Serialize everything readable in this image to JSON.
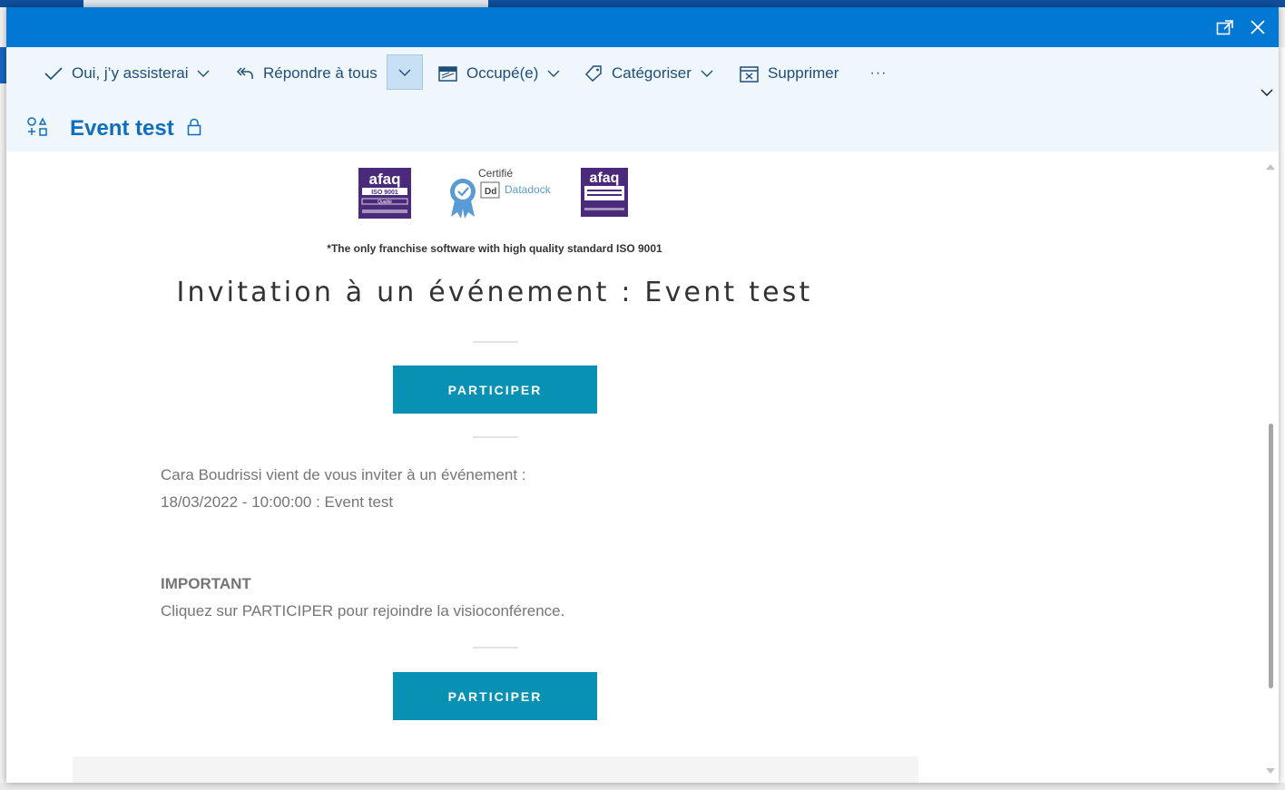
{
  "window": {
    "popout_icon": "popout-icon",
    "close_icon": "close-icon"
  },
  "toolbar": {
    "accept_label": "Oui, j’y assisterai",
    "reply_all_label": "Répondre à tous",
    "busy_label": "Occupé(e)",
    "categorize_label": "Catégoriser",
    "delete_label": "Supprimer",
    "more_label": "···"
  },
  "subject": {
    "title": "Event test"
  },
  "email": {
    "logo_afaq_1": "afaq",
    "logo_afaq_1_sub": "ISO 9001",
    "logo_afaq_1_sub2": "Qualité",
    "logo_certifie": "Certifié",
    "logo_datadock": "Datadock",
    "logo_afaq_2": "afaq",
    "tagline": "*The only franchise software with high quality standard ISO 9001",
    "heading": "Invitation à un événement : Event test",
    "cta_label": "PARTICIPER",
    "invite_line": "Cara Boudrissi vient de vous inviter à un événement :",
    "event_line": "18/03/2022 - 10:00:00 : Event test",
    "important_label": "IMPORTANT",
    "important_text": "Cliquez sur PARTICIPER pour rejoindre la visioconférence.",
    "cta_label_2": "PARTICIPER"
  },
  "colors": {
    "titlebar": "#0078d4",
    "ribbon": "#eff6fc",
    "accent_text": "#106ebe",
    "cta": "#0891b2",
    "logo_purple": "#4b2a7b"
  }
}
